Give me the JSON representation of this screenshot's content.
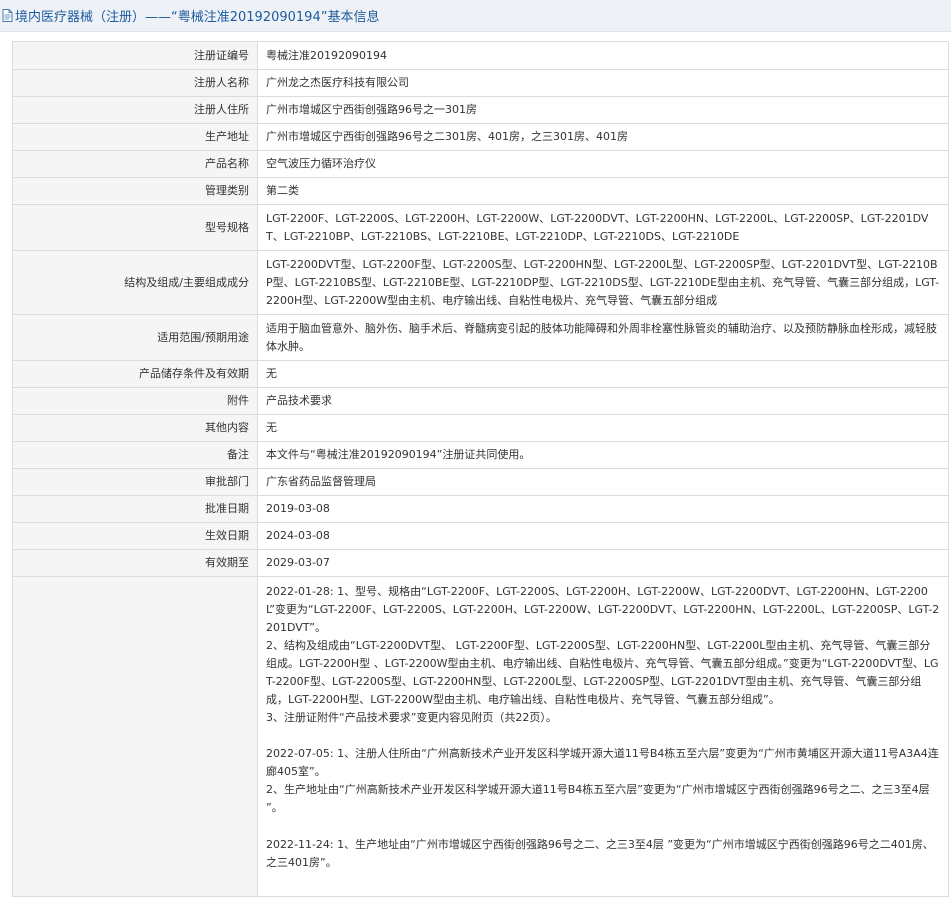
{
  "header": {
    "icon": "document-icon",
    "title": "境内医疗器械（注册）——“粤械注准20192090194”基本信息"
  },
  "rows": [
    {
      "label": "注册证编号",
      "value": "粤械注准20192090194"
    },
    {
      "label": "注册人名称",
      "value": "广州龙之杰医疗科技有限公司"
    },
    {
      "label": "注册人住所",
      "value": "广州市增城区宁西街创强路96号之一301房"
    },
    {
      "label": "生产地址",
      "value": "广州市增城区宁西街创强路96号之二301房、401房，之三301房、401房"
    },
    {
      "label": "产品名称",
      "value": "空气波压力循环治疗仪"
    },
    {
      "label": "管理类别",
      "value": "第二类"
    },
    {
      "label": "型号规格",
      "value": "LGT-2200F、LGT-2200S、LGT-2200H、LGT-2200W、LGT-2200DVT、LGT-2200HN、LGT-2200L、LGT-2200SP、LGT-2201DVT、LGT-2210BP、LGT-2210BS、LGT-2210BE、LGT-2210DP、LGT-2210DS、LGT-2210DE"
    },
    {
      "label": "结构及组成/主要组成成分",
      "value": "LGT-2200DVT型、LGT-2200F型、LGT-2200S型、LGT-2200HN型、LGT-2200L型、LGT-2200SP型、LGT-2201DVT型、LGT-2210BP型、LGT-2210BS型、LGT-2210BE型、LGT-2210DP型、LGT-2210DS型、LGT-2210DE型由主机、充气导管、气囊三部分组成，LGT-2200H型、LGT-2200W型由主机、电疗输出线、自粘性电极片、充气导管、气囊五部分组成"
    },
    {
      "label": "适用范围/预期用途",
      "value": "适用于脑血管意外、脑外伤、脑手术后、脊髓病变引起的肢体功能障碍和外周非栓塞性脉管炎的辅助治疗、以及预防静脉血栓形成，减轻肢体水肿。"
    },
    {
      "label": "产品储存条件及有效期",
      "value": "无"
    },
    {
      "label": "附件",
      "value": "产品技术要求"
    },
    {
      "label": "其他内容",
      "value": "无"
    },
    {
      "label": "备注",
      "value": "本文件与“粤械注准20192090194”注册证共同使用。"
    },
    {
      "label": "审批部门",
      "value": "广东省药品监督管理局"
    },
    {
      "label": "批准日期",
      "value": "2019-03-08"
    },
    {
      "label": "生效日期",
      "value": "2024-03-08"
    },
    {
      "label": "有效期至",
      "value": "2029-03-07"
    }
  ],
  "history": [
    [
      "2022-01-28: 1、型号、规格由“LGT-2200F、LGT-2200S、LGT-2200H、LGT-2200W、LGT-2200DVT、LGT-2200HN、LGT-2200L”变更为“LGT-2200F、LGT-2200S、LGT-2200H、LGT-2200W、LGT-2200DVT、LGT-2200HN、LGT-2200L、LGT-2200SP、LGT-2201DVT”。",
      "2、结构及组成由“LGT-2200DVT型、 LGT-2200F型、LGT-2200S型、LGT-2200HN型、LGT-2200L型由主机、充气导管、气囊三部分组成。LGT-2200H型 、LGT-2200W型由主机、电疗输出线、自粘性电极片、充气导管、气囊五部分组成。”变更为“LGT-2200DVT型、LGT-2200F型、LGT-2200S型、LGT-2200HN型、LGT-2200L型、LGT-2200SP型、LGT-2201DVT型由主机、充气导管、气囊三部分组成，LGT-2200H型、LGT-2200W型由主机、电疗输出线、自粘性电极片、充气导管、气囊五部分组成”。",
      "3、注册证附件“产品技术要求”变更内容见附页（共22页）。"
    ],
    [
      "2022-07-05: 1、注册人住所由“广州高新技术产业开发区科学城开源大道11号B4栋五至六层”变更为“广州市黄埔区开源大道11号A3A4连廊405室”。",
      "2、生产地址由“广州高新技术产业开发区科学城开源大道11号B4栋五至六层”变更为“广州市增城区宁西街创强路96号之二、之三3至4层 ”。"
    ],
    [
      "2022-11-24: 1、生产地址由“广州市增城区宁西街创强路96号之二、之三3至4层 ”变更为“广州市增城区宁西街创强路96号之二401房、之三401房”。"
    ]
  ]
}
